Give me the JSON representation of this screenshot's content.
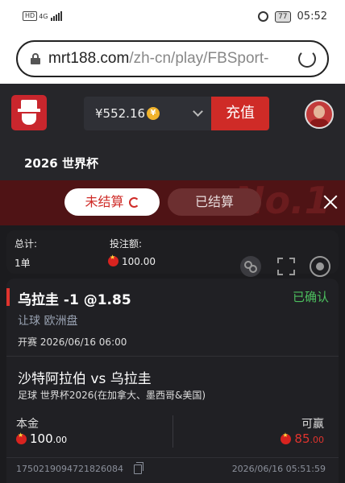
{
  "status_bar": {
    "hd": "HD",
    "network": "4G",
    "battery": "77",
    "time": "05:52"
  },
  "browser": {
    "url_domain": "mrt188.com",
    "url_path": "/zh-cn/play/FBSport-"
  },
  "header": {
    "balance": "¥552.16",
    "coin_glyph": "¥",
    "recharge_label": "充值",
    "event_title": "2026 世界杯",
    "watermark": "No.1"
  },
  "tabs": {
    "unsettled_label": "未结算",
    "settled_label": "已结算"
  },
  "summary": {
    "total_label": "总计:",
    "total_value": "1单",
    "stake_label": "投注额:",
    "stake_value": "100.00"
  },
  "bet": {
    "selection": "乌拉圭 -1 @1.85",
    "status": "已确认",
    "market": "让球 欧洲盘",
    "kickoff": "开赛 2026/06/16 06:00",
    "match": "沙特阿拉伯 vs 乌拉圭",
    "league": "足球  世界杯2026(在加拿大、墨西哥&美国)",
    "stake_label": "本金",
    "stake_int": "100",
    "stake_dec": ".00",
    "win_label": "可赢",
    "win_int": "85",
    "win_dec": ".00",
    "bet_id": "1750219094721826084",
    "bet_time": "2026/06/16 05:51:59"
  },
  "colors": {
    "accent_red": "#cf2b27",
    "confirmed_green": "#4cbf5e",
    "background": "#1b1b1e"
  }
}
